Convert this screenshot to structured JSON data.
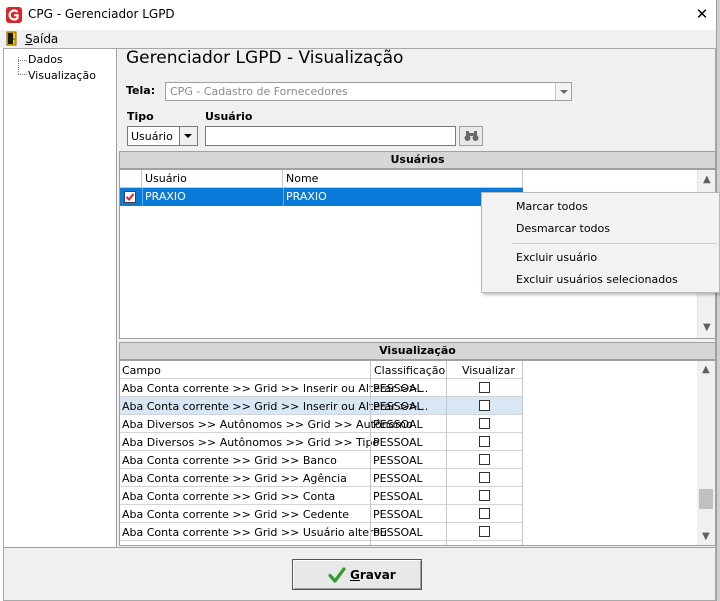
{
  "window": {
    "title": "CPG - Gerenciador LGPD",
    "close_glyph": "✕"
  },
  "menu": {
    "exit_first": "S",
    "exit_rest": "aída"
  },
  "tree": {
    "items": [
      "Dados",
      "Visualização"
    ]
  },
  "page": {
    "title": "Gerenciador LGPD - Visualização"
  },
  "filters": {
    "tela_label": "Tela:",
    "tela_value": "CPG - Cadastro de Fornecedores",
    "tipo_label": "Tipo",
    "tipo_value": "Usuário",
    "usuario_label": "Usuário",
    "usuario_value": ""
  },
  "users_panel": {
    "header": "Usuários",
    "columns": [
      "Usuário",
      "Nome"
    ],
    "rows": [
      {
        "usuario": "PRAXIO",
        "nome": "PRAXIO",
        "checked": true
      }
    ]
  },
  "context_menu": {
    "items": [
      "Marcar todos",
      "Desmarcar todos",
      "Excluir usuário",
      "Excluir usuários selecionados"
    ]
  },
  "viz_panel": {
    "header": "Visualização",
    "columns": [
      "Campo",
      "Classificação",
      "Visualizar"
    ],
    "rows": [
      {
        "campo": "Aba Conta corrente >> Grid >> Inserir ou Alterar >>...",
        "classificacao": "PESSOAL",
        "visualizar": false
      },
      {
        "campo": "Aba Conta corrente >> Grid >> Inserir ou Alterar >>...",
        "classificacao": "PESSOAL",
        "visualizar": false
      },
      {
        "campo": "Aba Diversos >> Autônomos >> Grid >> Autônomo",
        "classificacao": "PESSOAL",
        "visualizar": false
      },
      {
        "campo": "Aba Diversos >> Autônomos >> Grid >> Tipo",
        "classificacao": "PESSOAL",
        "visualizar": false
      },
      {
        "campo": "Aba Conta corrente >> Grid >> Banco",
        "classificacao": "PESSOAL",
        "visualizar": false
      },
      {
        "campo": "Aba Conta corrente >> Grid >> Agência",
        "classificacao": "PESSOAL",
        "visualizar": false
      },
      {
        "campo": "Aba Conta corrente >> Grid >> Conta",
        "classificacao": "PESSOAL",
        "visualizar": false
      },
      {
        "campo": "Aba Conta corrente >> Grid >> Cedente",
        "classificacao": "PESSOAL",
        "visualizar": false
      },
      {
        "campo": "Aba Conta corrente >> Grid >> Usuário alterou",
        "classificacao": "PESSOAL",
        "visualizar": false
      }
    ]
  },
  "footer": {
    "save_first": "G",
    "save_rest": "ravar"
  },
  "colors": {
    "selection": "#0a7ad8",
    "logo_red": "#d8262c",
    "check_green": "#2e9e2e"
  }
}
